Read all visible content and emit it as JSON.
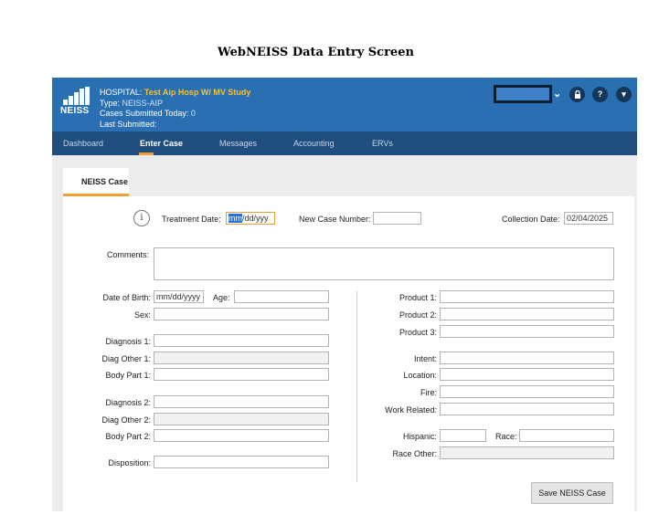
{
  "page_title": "WebNEISS Data Entry Screen",
  "header": {
    "logo_text": "NEISS",
    "hospital_label": "HOSPITAL:",
    "hospital_value": "Test Aip Hosp W/ MV Study",
    "type_label": "Type:",
    "type_value": "NEISS-AIP",
    "cases_label": "Cases Submitted Today:",
    "cases_value": "0",
    "last_label": "Last Submitted:",
    "last_value": "",
    "chevron": "⌄",
    "lock_icon": "🔒",
    "help_icon": "?",
    "menu_icon": "▾"
  },
  "nav": {
    "items": [
      "Dashboard",
      "Enter Case",
      "Messages",
      "Accounting",
      "ERVs"
    ],
    "active": "Enter Case"
  },
  "tab": {
    "label": "NEISS Case"
  },
  "form": {
    "info_icon": "i",
    "treatment_date_label": "Treatment Date:",
    "treatment_date_sel": "mm",
    "treatment_date_rest": "/dd/yyy",
    "new_case_label": "New Case Number:",
    "new_case_value": "",
    "collection_date_label": "Collection Date:",
    "collection_date_value": "02/04/2025",
    "comments_label": "Comments:",
    "dob_label": "Date of Birth:",
    "dob_placeholder": "mm/dd/yyyy",
    "age_label": "Age:",
    "sex_label": "Sex:",
    "diagnosis1_label": "Diagnosis 1:",
    "diag_other1_label": "Diag Other 1:",
    "body_part1_label": "Body Part 1:",
    "diagnosis2_label": "Diagnosis 2:",
    "diag_other2_label": "Diag Other 2:",
    "body_part2_label": "Body Part 2:",
    "disposition_label": "Disposition:",
    "product1_label": "Product 1:",
    "product2_label": "Product 2:",
    "product3_label": "Product 3:",
    "intent_label": "Intent:",
    "location_label": "Location:",
    "fire_label": "Fire:",
    "work_related_label": "Work Related:",
    "hispanic_label": "Hispanic:",
    "race_label": "Race:",
    "race_other_label": "Race Other:",
    "save_label": "Save NEISS Case"
  },
  "colors": {
    "header_bg": "#2b6fb3",
    "nav_bg": "#1f4e7e",
    "accent": "#f0a030",
    "hospital_name": "#f1c232"
  }
}
